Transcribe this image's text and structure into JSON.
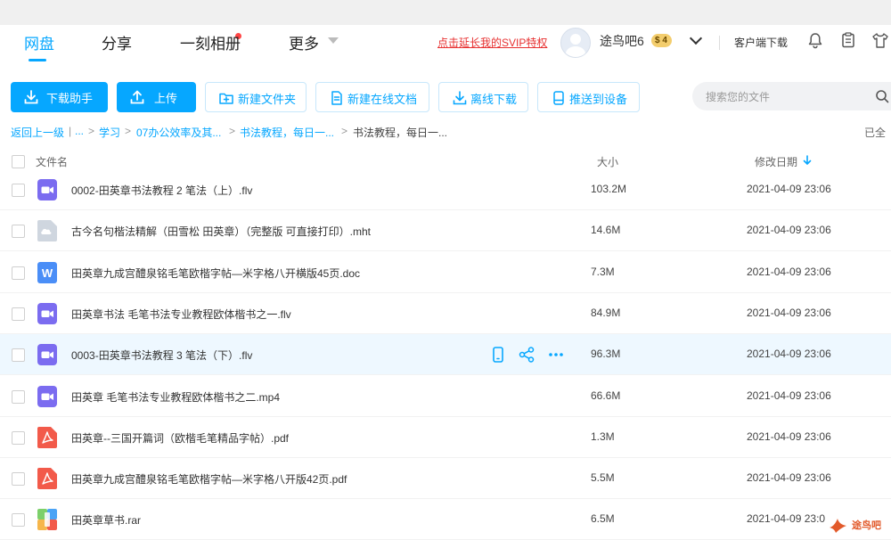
{
  "nav": {
    "tabs": [
      {
        "label": "网盘"
      },
      {
        "label": "分享"
      },
      {
        "label": "一刻相册"
      },
      {
        "label": "更多"
      }
    ]
  },
  "header": {
    "svip_link": "点击延长我的SVIP特权",
    "username": "途鸟吧6",
    "vip_badge": "$ 4",
    "client_download": "客户端下载",
    "icons": [
      "bell-icon",
      "clipboard-icon",
      "shirt-icon"
    ]
  },
  "toolbar": {
    "buttons": [
      {
        "label": "下载助手",
        "icon": "download-icon"
      },
      {
        "label": "上传",
        "icon": "upload-icon"
      },
      {
        "label": "新建文件夹",
        "icon": "new-folder-icon"
      },
      {
        "label": "新建在线文档",
        "icon": "document-icon"
      },
      {
        "label": "离线下载",
        "icon": "offline-download-icon"
      },
      {
        "label": "推送到设备",
        "icon": "device-icon"
      }
    ],
    "search_placeholder": "搜索您的文件"
  },
  "breadcrumb": {
    "items": [
      "返回上一级",
      "...",
      "学习",
      "07办公效率及其...",
      "书法教程，每日一..."
    ],
    "separators": [
      "|",
      ">",
      ">",
      ">",
      ">"
    ],
    "current": "书法教程，每日一...",
    "loaded_text": "已全"
  },
  "columns": {
    "name": "文件名",
    "size": "大小",
    "date": "修改日期"
  },
  "files": [
    {
      "name": "0002-田英章书法教程 2 笔法（上）.flv",
      "size": "103.2M",
      "date": "2021-04-09 23:06",
      "type": "video",
      "icon": "video-file-icon"
    },
    {
      "name": "古今名句楷法精解（田雪松 田英章）（完整版 可直接打印）.mht",
      "size": "14.6M",
      "date": "2021-04-09 23:06",
      "type": "other",
      "icon": "generic-file-icon"
    },
    {
      "name": "田英章九成宫醴泉铭毛笔欧楷字帖—米字格八开横版45页.doc",
      "size": "7.3M",
      "date": "2021-04-09 23:06",
      "type": "word",
      "icon": "word-file-icon"
    },
    {
      "name": "田英章书法 毛笔书法专业教程欧体楷书之一.flv",
      "size": "84.9M",
      "date": "2021-04-09 23:06",
      "type": "video",
      "icon": "video-file-icon"
    },
    {
      "name": "0003-田英章书法教程 3 笔法（下）.flv",
      "size": "96.3M",
      "date": "2021-04-09 23:06",
      "type": "video",
      "icon": "video-file-icon",
      "hover": true
    },
    {
      "name": "田英章 毛笔书法专业教程欧体楷书之二.mp4",
      "size": "66.6M",
      "date": "2021-04-09 23:06",
      "type": "video",
      "icon": "video-file-icon"
    },
    {
      "name": "田英章--三国开篇词（欧楷毛笔精品字帖）.pdf",
      "size": "1.3M",
      "date": "2021-04-09 23:06",
      "type": "pdf",
      "icon": "pdf-file-icon"
    },
    {
      "name": "田英章九成宫醴泉铭毛笔欧楷字帖—米字格八开版42页.pdf",
      "size": "5.5M",
      "date": "2021-04-09 23:06",
      "type": "pdf",
      "icon": "pdf-file-icon"
    },
    {
      "name": "田英章草书.rar",
      "size": "6.5M",
      "date": "2021-04-09 23:0",
      "type": "rar",
      "icon": "archive-file-icon"
    }
  ],
  "row_actions": [
    "push-to-device-icon",
    "share-icon",
    "more-icon"
  ],
  "watermark": {
    "text": "途鸟吧"
  },
  "colors": {
    "accent": "#06a7ff",
    "svip_red": "#e73030",
    "video_purple": "#7b6cf0",
    "word_blue": "#4a8ef7",
    "pdf_red": "#f25a4a",
    "hover_row": "#eef8ff"
  }
}
